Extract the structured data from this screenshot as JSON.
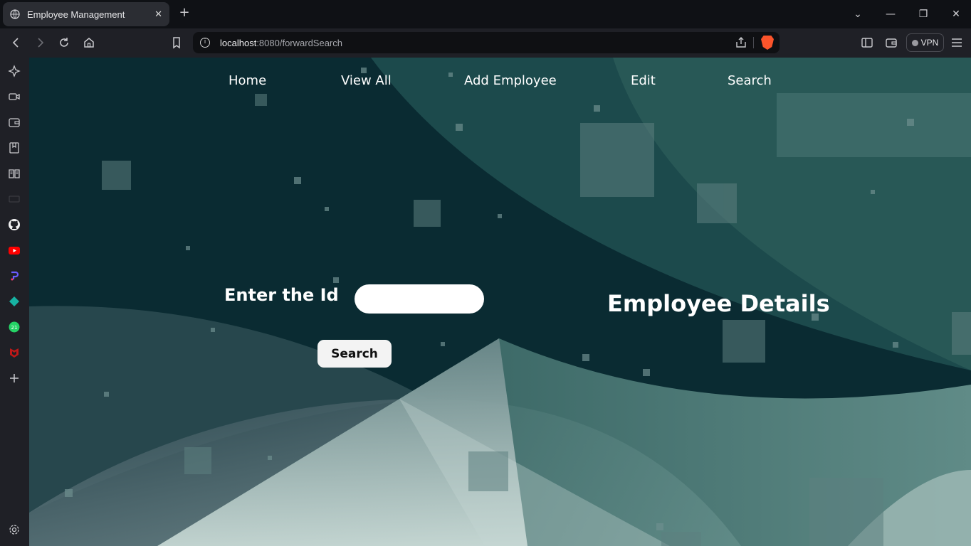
{
  "browser": {
    "tab_title": "Employee Management",
    "tab_close": "✕",
    "new_tab": "+",
    "window_controls": [
      "⌄",
      "—",
      "❐",
      "✕"
    ],
    "url_host": "localhost",
    "url_path": ":8080/forwardSearch",
    "vpn_label": "VPN"
  },
  "nav": {
    "items": [
      "Home",
      "View All",
      "Add Employee",
      "Edit",
      "Search"
    ]
  },
  "form": {
    "id_label": "Enter the Id",
    "id_value": "",
    "search_label": "Search"
  },
  "details": {
    "title": "Employee Details"
  },
  "icons": {
    "back": "back-icon",
    "forward": "forward-icon",
    "reload": "reload-icon",
    "home": "home-icon",
    "bookmark": "bookmark-icon",
    "site_info": "info-icon",
    "share": "share-icon",
    "brave": "brave-shield-icon",
    "sidebar_toggle": "sidebar-icon",
    "wallet": "wallet-icon",
    "menu": "menu-icon"
  },
  "colors": {
    "page_teal_dark": "#06232b",
    "page_teal_light": "#6e9a94",
    "brave_orange": "#fb542b"
  }
}
